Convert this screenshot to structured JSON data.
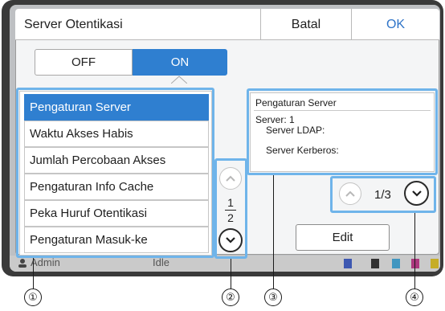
{
  "dialog": {
    "title": "Server Otentikasi",
    "cancel_label": "Batal",
    "ok_label": "OK"
  },
  "toggle": {
    "off_label": "OFF",
    "on_label": "ON",
    "selected": "ON"
  },
  "menu": {
    "items": [
      {
        "label": "Pengaturan Server",
        "selected": true
      },
      {
        "label": "Waktu Akses Habis",
        "selected": false
      },
      {
        "label": "Jumlah Percobaan Akses",
        "selected": false
      },
      {
        "label": "Pengaturan Info Cache",
        "selected": false
      },
      {
        "label": "Peka Huruf Otentikasi",
        "selected": false
      },
      {
        "label": "Pengaturan Masuk-ke",
        "selected": false
      }
    ],
    "page_current": "1",
    "page_total": "2"
  },
  "detail": {
    "title": "Pengaturan Server",
    "server_line": "Server: 1",
    "ldap_line": "Server LDAP:",
    "kerberos_line": "Server Kerberos:",
    "page_label": "1/3",
    "edit_label": "Edit"
  },
  "status": {
    "user": "Admin",
    "state": "Idle"
  },
  "annotations": [
    "①",
    "②",
    "③",
    "④"
  ],
  "colors": {
    "accent": "#2f7fd0",
    "callout": "#6fb4ea",
    "ok_text": "#2f74c8"
  },
  "icons": {
    "scroll_up": "chevron-up-icon",
    "scroll_down": "chevron-down-icon",
    "user": "user-icon"
  }
}
